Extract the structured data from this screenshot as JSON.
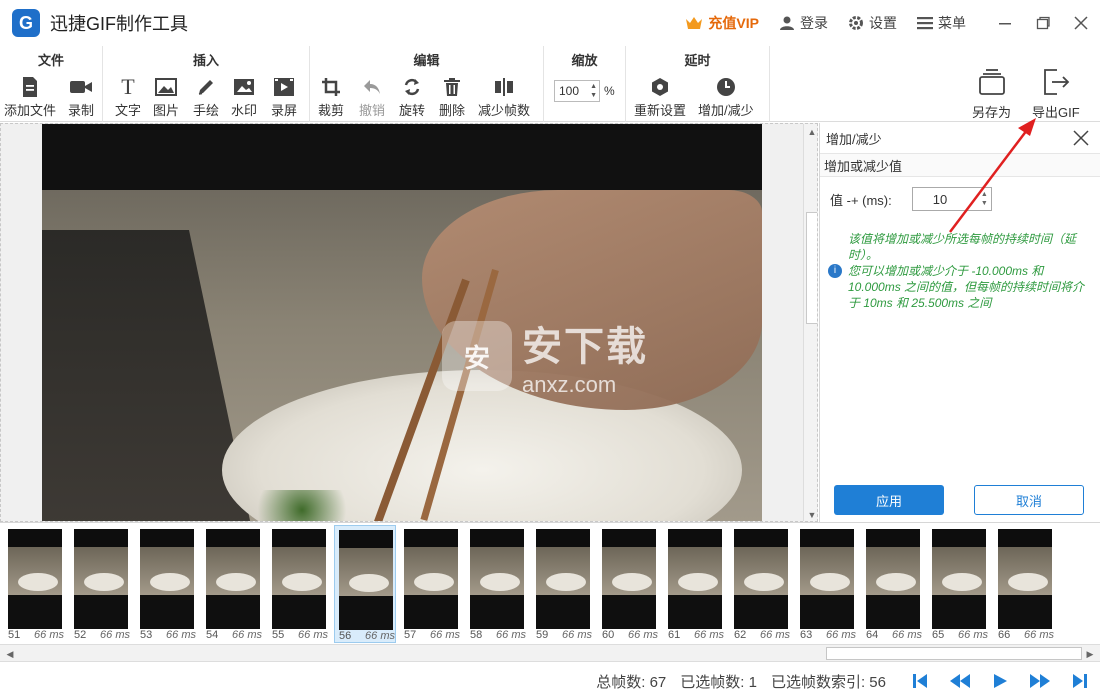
{
  "app": {
    "logo": "G",
    "title": "迅捷GIF制作工具"
  },
  "title_actions": {
    "vip": "充值VIP",
    "login": "登录",
    "settings": "设置",
    "menu": "菜单"
  },
  "toolbar": {
    "groups": {
      "file": "文件",
      "insert": "插入",
      "edit": "编辑",
      "zoom": "缩放",
      "delay": "延时"
    },
    "tools": {
      "add_file": "添加文件",
      "record": "录制",
      "text": "文字",
      "image": "图片",
      "draw": "手绘",
      "watermark": "水印",
      "screen_record": "录屏",
      "crop": "裁剪",
      "undo": "撤销",
      "rotate": "旋转",
      "delete": "删除",
      "reduce_frames": "减少帧数",
      "reset": "重新设置",
      "add_reduce": "增加/减少"
    },
    "zoom_value": "100",
    "zoom_unit": "%",
    "save_as": "另存为",
    "export_gif": "导出GIF"
  },
  "preview": {
    "watermark_logo": "安",
    "watermark_text": "安下载",
    "watermark_sub": "anxz.com"
  },
  "panel": {
    "title": "增加/减少",
    "section": "增加或减少值",
    "field_label": "值 -+ (ms):",
    "field_value": "10",
    "hint1": "该值将增加或减少所选每帧的持续时间（延时）。",
    "hint2": "您可以增加或减少介于 -10.000ms 和 10.000ms 之间的值，但每帧的持续时间将介于 10ms 和 25.500ms 之间",
    "apply": "应用",
    "cancel": "取消"
  },
  "frames": [
    {
      "num": "51",
      "ms": "66 ms"
    },
    {
      "num": "52",
      "ms": "66 ms"
    },
    {
      "num": "53",
      "ms": "66 ms"
    },
    {
      "num": "54",
      "ms": "66 ms"
    },
    {
      "num": "55",
      "ms": "66 ms"
    },
    {
      "num": "56",
      "ms": "66 ms",
      "selected": true
    },
    {
      "num": "57",
      "ms": "66 ms"
    },
    {
      "num": "58",
      "ms": "66 ms"
    },
    {
      "num": "59",
      "ms": "66 ms"
    },
    {
      "num": "60",
      "ms": "66 ms"
    },
    {
      "num": "61",
      "ms": "66 ms"
    },
    {
      "num": "62",
      "ms": "66 ms"
    },
    {
      "num": "63",
      "ms": "66 ms"
    },
    {
      "num": "64",
      "ms": "66 ms"
    },
    {
      "num": "65",
      "ms": "66 ms"
    },
    {
      "num": "66",
      "ms": "66 ms"
    }
  ],
  "status": {
    "total": "总帧数: 67",
    "selected": "已选帧数: 1",
    "index": "已选帧数索引: 56"
  },
  "colors": {
    "accent": "#1f7fd6",
    "hint_green": "#2e9a3f",
    "vip_orange": "#e5690b",
    "arrow_red": "#e02020"
  }
}
